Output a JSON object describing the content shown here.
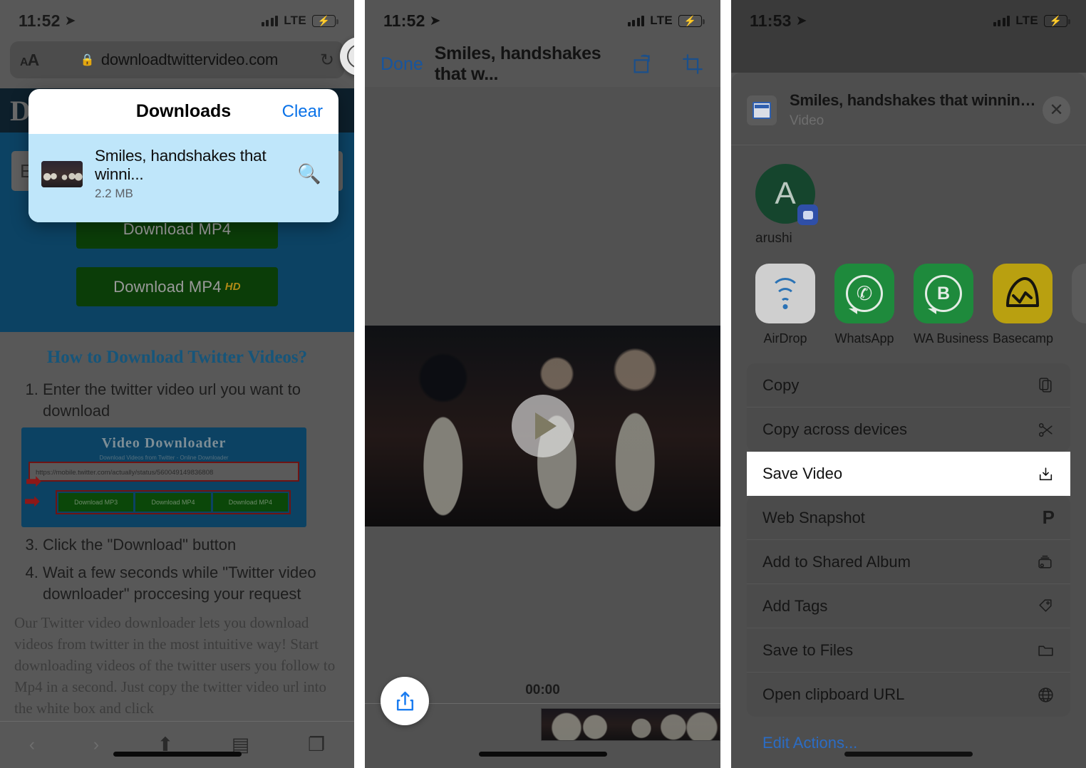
{
  "panel1": {
    "status": {
      "time": "11:52",
      "carrier": "LTE",
      "location_icon": "location-arrow-icon"
    },
    "browser": {
      "text_size_label_big": "A",
      "text_size_label_small": "A",
      "lock_icon": "lock-icon",
      "url": "downloadtwittervideo.com",
      "reload_icon": "reload-icon",
      "download_icon": "download-arrow-icon"
    },
    "downloads_popup": {
      "title": "Downloads",
      "clear_label": "Clear",
      "item": {
        "name": "Smiles, handshakes that winni...",
        "size": "2.2 MB",
        "search_icon": "magnifier-icon",
        "thumbnail": "video-thumbnail"
      }
    },
    "page": {
      "logo": "D",
      "url_input_placeholder": "Enter Twitter url",
      "button_mp4": "Download MP4",
      "button_mp4_hd": "Download MP4",
      "button_hd_sup": "HD",
      "heading": "How to Download Twitter Videos?",
      "steps": [
        "Enter the twitter video url you want to download",
        "Click the \"Download\" button",
        "Wait a few seconds while \"Twitter video downloader\" proccesing your request"
      ],
      "screenshot": {
        "title": "Video Downloader",
        "subtitle": "Download Videos from Twitter - Online Downloader",
        "url_value": "https://mobile.twitter.com/actually/status/560049149836808",
        "buttons": [
          "Download MP3",
          "Download MP4",
          "Download MP4"
        ]
      },
      "paragraph": "Our Twitter video downloader lets you download videos from twitter in the most intuitive way! Start downloading videos of the twitter users you follow to Mp4 in a second. Just copy the twitter video url into the white box and click"
    },
    "toolbar": {
      "back_icon": "chevron-left-icon",
      "forward_icon": "chevron-right-icon",
      "share_icon": "share-icon",
      "bookmarks_icon": "book-icon",
      "tabs_icon": "tabs-icon"
    }
  },
  "panel2": {
    "status": {
      "time": "11:52",
      "carrier": "LTE"
    },
    "nav": {
      "done_label": "Done",
      "title": "Smiles, handshakes that w...",
      "rotate_icon": "rotate-icon",
      "crop_icon": "crop-icon"
    },
    "player": {
      "play_icon": "play-icon",
      "timecode": "00:00",
      "share_icon": "share-icon",
      "scrubber": "video-filmstrip"
    }
  },
  "panel3": {
    "status": {
      "time": "11:53",
      "carrier": "LTE"
    },
    "header": {
      "title": "Smiles, handshakes that winning feeling! - -...",
      "subtitle": "Video",
      "file_icon": "video-file-icon",
      "close_icon": "close-icon"
    },
    "people": [
      {
        "name": "arushi",
        "initial": "A",
        "badge_icon": "messages-badge-icon"
      }
    ],
    "apps": [
      {
        "label": "AirDrop",
        "icon": "airdrop-icon"
      },
      {
        "label": "WhatsApp",
        "icon": "whatsapp-icon"
      },
      {
        "label": "WA Business",
        "icon": "whatsapp-business-icon"
      },
      {
        "label": "Basecamp",
        "icon": "basecamp-icon"
      },
      {
        "label": "",
        "icon": "slack-icon"
      }
    ],
    "actions": [
      {
        "label": "Copy",
        "icon": "copy-icon",
        "highlighted": false
      },
      {
        "label": "Copy across devices",
        "icon": "scissors-icon",
        "highlighted": false
      },
      {
        "label": "Save Video",
        "icon": "save-download-icon",
        "highlighted": true
      },
      {
        "label": "Web Snapshot",
        "icon": "pocket-p-icon",
        "highlighted": false
      },
      {
        "label": "Add to Shared Album",
        "icon": "shared-album-icon",
        "highlighted": false
      },
      {
        "label": "Add Tags",
        "icon": "tag-icon",
        "highlighted": false
      },
      {
        "label": "Save to Files",
        "icon": "folder-icon",
        "highlighted": false
      },
      {
        "label": "Open clipboard URL",
        "icon": "globe-icon",
        "highlighted": false
      }
    ],
    "edit_actions_label": "Edit Actions..."
  }
}
